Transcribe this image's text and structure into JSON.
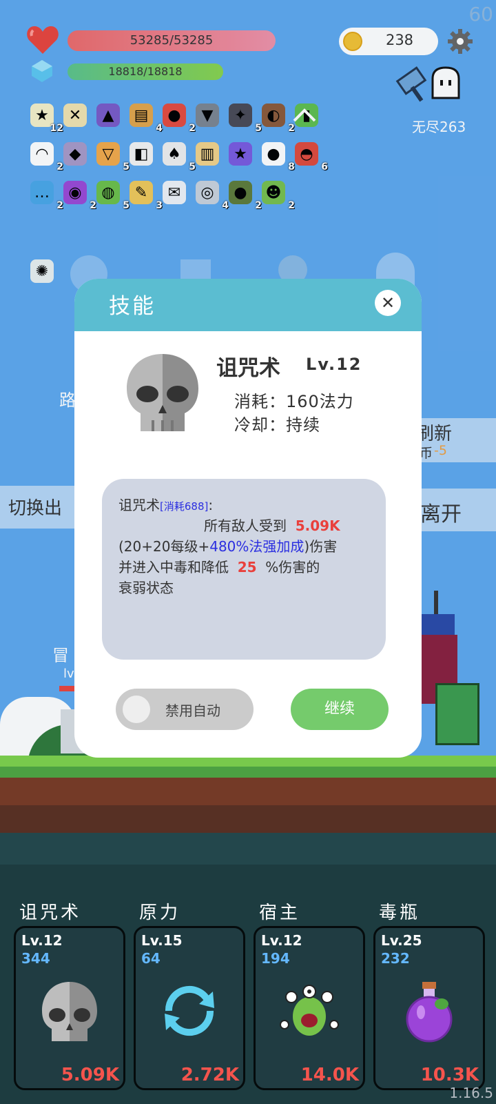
{
  "fps": "60",
  "version": "1.16.5",
  "player": {
    "hp": "53285/53285",
    "mp": "18818/18818"
  },
  "coins": "238",
  "endless_label": "无尽263",
  "inventory": [
    {
      "icon": "star-card-icon",
      "glyph": "★",
      "bg": "#f5f0c8",
      "count": "12"
    },
    {
      "icon": "treasure-map-icon",
      "glyph": "✕",
      "bg": "#f1e3b0",
      "count": ""
    },
    {
      "icon": "wizard-hat-icon",
      "glyph": "▲",
      "bg": "#7a5bc8",
      "count": ""
    },
    {
      "icon": "spell-book-icon",
      "glyph": "▤",
      "bg": "#e2a54b",
      "count": "4"
    },
    {
      "icon": "apple-icon",
      "glyph": "●",
      "bg": "#e54b3f",
      "count": "2"
    },
    {
      "icon": "mortar-icon",
      "glyph": "▼",
      "bg": "#7c8591",
      "count": ""
    },
    {
      "icon": "bat-icon",
      "glyph": "✦",
      "bg": "#4a4a55",
      "count": "5"
    },
    {
      "icon": "coconut-icon",
      "glyph": "◐",
      "bg": "#8c5a3a",
      "count": "2"
    },
    {
      "icon": "green-card-icon",
      "glyph": "▮",
      "bg": "#5fbf4f",
      "count": ""
    },
    {
      "icon": "ghost-icon",
      "glyph": "◠",
      "bg": "#ffffff",
      "count": "2"
    },
    {
      "icon": "unicorn-horn-icon",
      "glyph": "◆",
      "bg": "#a79ac8",
      "count": ""
    },
    {
      "icon": "ice-cream-icon",
      "glyph": "▽",
      "bg": "#f2a94a",
      "count": "5"
    },
    {
      "icon": "pill-icon",
      "glyph": "◧",
      "bg": "#f3f3f3",
      "count": ""
    },
    {
      "icon": "playing-cards-icon",
      "glyph": "♠",
      "bg": "#efefef",
      "count": "5"
    },
    {
      "icon": "scroll-icon",
      "glyph": "▥",
      "bg": "#f2d28a",
      "count": ""
    },
    {
      "icon": "gift-box-icon",
      "glyph": "★",
      "bg": "#7a5be0",
      "count": ""
    },
    {
      "icon": "fried-egg-icon",
      "glyph": "●",
      "bg": "#ffffff",
      "count": "8"
    },
    {
      "icon": "mushroom-icon",
      "glyph": "◓",
      "bg": "#e04a3c",
      "count": "6"
    },
    {
      "icon": "speech-bubble-icon",
      "glyph": "…",
      "bg": "#4aa7e8",
      "count": "2"
    },
    {
      "icon": "crystal-ball-icon",
      "glyph": "◉",
      "bg": "#9b49d6",
      "count": "2"
    },
    {
      "icon": "lime-icon",
      "glyph": "◍",
      "bg": "#6cc04a",
      "count": "5"
    },
    {
      "icon": "map-pencil-icon",
      "glyph": "✎",
      "bg": "#f0c85a",
      "count": "3"
    },
    {
      "icon": "envelope-icon",
      "glyph": "✉",
      "bg": "#eef2f7",
      "count": ""
    },
    {
      "icon": "compass-icon",
      "glyph": "◎",
      "bg": "#c9d2dc",
      "count": "4"
    },
    {
      "icon": "grenade-icon",
      "glyph": "●",
      "bg": "#5e7c3a",
      "count": "2"
    },
    {
      "icon": "zombie-icon",
      "glyph": "☻",
      "bg": "#77c04e",
      "count": "2"
    },
    {
      "icon": "lamp-card-icon",
      "glyph": "✺",
      "bg": "#e8f0f0",
      "count": ""
    }
  ],
  "behind": {
    "left_button": "切换出",
    "refresh": "刷新",
    "refresh_cost_label": "金币",
    "refresh_cost": "-5",
    "leave": "离开",
    "path_label": "路",
    "adventurer_label": "冒",
    "adventurer_lv": "lv"
  },
  "dialog": {
    "title": "技能",
    "skill_name": "诅咒术",
    "level": "Lv.12",
    "cost_line": "消耗：160法力",
    "cooldown_line": "冷却：持续",
    "desc": {
      "name": "诅咒术",
      "cost_tag": "[消耗688]",
      "colon": ":",
      "l2a": "所有敌人受到",
      "dmg": "5.09K",
      "l3a": "(20+20每级+",
      "bonus": "480%法强加成",
      "l3c": ")伤害",
      "l4a": "并进入中毒和降低",
      "pct": "25",
      "l4c": "%伤害的",
      "l5": "衰弱状态"
    },
    "toggle_label": "禁用自动",
    "continue_label": "继续"
  },
  "skills": [
    {
      "name": "诅咒术",
      "level": "Lv.12",
      "cost": "344",
      "damage": "5.09K",
      "icon": "skull-icon"
    },
    {
      "name": "原力",
      "level": "Lv.15",
      "cost": "64",
      "damage": "2.72K",
      "icon": "cycle-arrows-icon"
    },
    {
      "name": "宿主",
      "level": "Lv.12",
      "cost": "194",
      "damage": "14.0K",
      "icon": "green-monster-icon"
    },
    {
      "name": "毒瓶",
      "level": "Lv.25",
      "cost": "232",
      "damage": "10.3K",
      "icon": "poison-bottle-icon"
    }
  ]
}
